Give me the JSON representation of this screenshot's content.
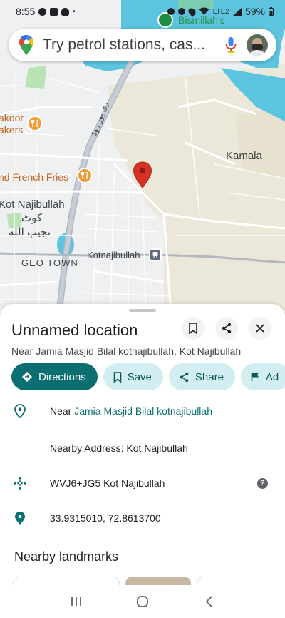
{
  "status_bar": {
    "time": "8:55",
    "battery": "59%",
    "network": "LTE2"
  },
  "map": {
    "labels": {
      "kamala": "Kamala",
      "kot_najibullah": "Kot Najibullah",
      "kot_najibullah_urdu_1": "کوٹ",
      "kot_najibullah_urdu_2": "نجیب الله",
      "geo_town": "GEO TOWN",
      "kotnajibullah_station": "Kotnajibullah",
      "bakers_1": "akoor",
      "bakers_2": "akers",
      "french_fries": "nd French Fries",
      "bismillahs": "Bismillah's",
      "road_label": "ری یور روڈ"
    }
  },
  "search": {
    "placeholder": "Try petrol stations, cas..."
  },
  "place": {
    "title": "Unnamed location",
    "subtitle": "Near Jamia Masjid Bilal kotnajibullah, Kot Najibullah"
  },
  "actions": {
    "directions": "Directions",
    "save": "Save",
    "share": "Share",
    "more": "Ad"
  },
  "details": {
    "near_prefix": "Near ",
    "near_link": "Jamia Masjid Bilal kotnajibullah",
    "nearby_address": "Nearby Address: Kot Najibullah",
    "plus_code": "WVJ6+JG5 Kot Najibullah",
    "coordinates": "33.9315010, 72.8613700"
  },
  "nearby": {
    "heading": "Nearby landmarks"
  },
  "colors": {
    "accent": "#0b6e70",
    "chip_bg": "#d3eef0",
    "pin": "#d93025",
    "river": "#5cc4de"
  }
}
